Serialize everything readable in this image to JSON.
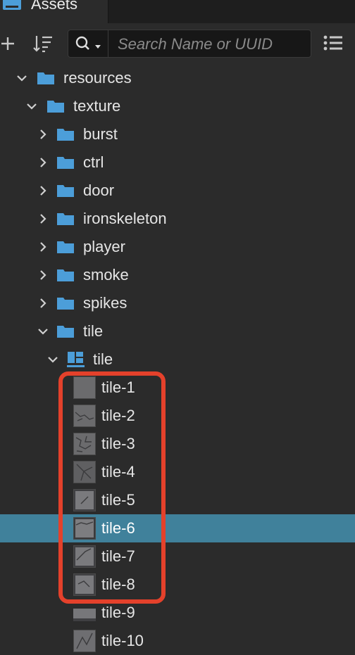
{
  "panel": {
    "tab_label": "Assets",
    "search_placeholder": "Search Name or UUID"
  },
  "icons": {
    "tab": "assets-icon",
    "add": "add-icon",
    "sort": "sort-icon",
    "search": "search-icon",
    "menu": "list-menu-icon"
  },
  "tree": {
    "items": [
      {
        "label": "resources",
        "depth": 0,
        "expanded": true,
        "kind": "folder"
      },
      {
        "label": "texture",
        "depth": 1,
        "expanded": true,
        "kind": "folder"
      },
      {
        "label": "burst",
        "depth": 2,
        "expanded": false,
        "kind": "folder"
      },
      {
        "label": "ctrl",
        "depth": 2,
        "expanded": false,
        "kind": "folder"
      },
      {
        "label": "door",
        "depth": 2,
        "expanded": false,
        "kind": "folder"
      },
      {
        "label": "ironskeleton",
        "depth": 2,
        "expanded": false,
        "kind": "folder"
      },
      {
        "label": "player",
        "depth": 2,
        "expanded": false,
        "kind": "folder"
      },
      {
        "label": "smoke",
        "depth": 2,
        "expanded": false,
        "kind": "folder"
      },
      {
        "label": "spikes",
        "depth": 2,
        "expanded": false,
        "kind": "folder"
      },
      {
        "label": "tile",
        "depth": 2,
        "expanded": true,
        "kind": "folder"
      },
      {
        "label": "tile",
        "depth": 3,
        "expanded": true,
        "kind": "atlas"
      },
      {
        "label": "tile-1",
        "kind": "sprite"
      },
      {
        "label": "tile-2",
        "kind": "sprite"
      },
      {
        "label": "tile-3",
        "kind": "sprite"
      },
      {
        "label": "tile-4",
        "kind": "sprite"
      },
      {
        "label": "tile-5",
        "kind": "sprite"
      },
      {
        "label": "tile-6",
        "kind": "sprite",
        "selected": true
      },
      {
        "label": "tile-7",
        "kind": "sprite"
      },
      {
        "label": "tile-8",
        "kind": "sprite"
      },
      {
        "label": "tile-9",
        "kind": "sprite"
      },
      {
        "label": "tile-10",
        "kind": "sprite"
      }
    ]
  },
  "colors": {
    "selection": "#40819b",
    "folder": "#4c9ed9",
    "highlight": "#e4412b"
  }
}
